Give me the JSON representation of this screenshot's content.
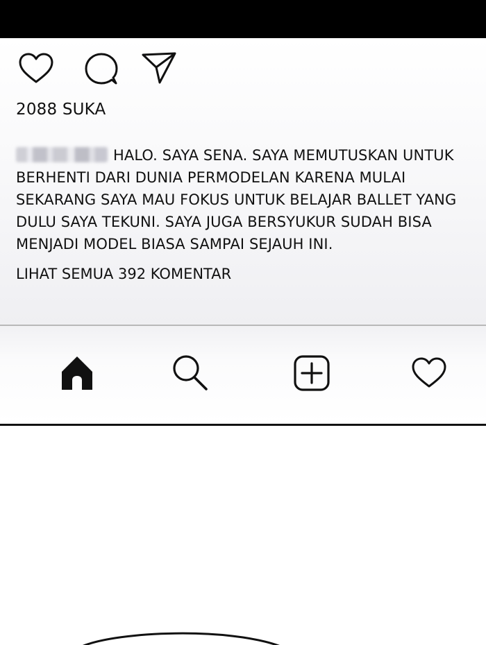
{
  "post": {
    "likes_text": "2088 SUKA",
    "username": "",
    "caption_text": "HALO. SAYA SENA. SAYA MEMUTUSKAN UNTUK BERHENTI DARI DUNIA PERMODELAN KARENA MULAI SEKARANG SAYA MAU FOKUS UNTUK BELAJAR BALLET YANG DULU SAYA TEKUNI. SAYA JUGA BERSYUKUR SUDAH BISA MENJADI MODEL BIASA SAMPAI SEJAUH INI.",
    "view_comments_text": "LIHAT SEMUA 392 KOMENTAR",
    "actions": [
      "heart-icon",
      "comment-icon",
      "send-icon"
    ]
  },
  "tab_bar": {
    "tabs": [
      "home-icon",
      "search-icon",
      "add-post-icon",
      "activity-heart-icon"
    ]
  },
  "colors": {
    "top_bar": "#000000",
    "panel_bg": "#f6f6f8",
    "divider": "#b8b8b8",
    "icon_stroke": "#111111"
  }
}
